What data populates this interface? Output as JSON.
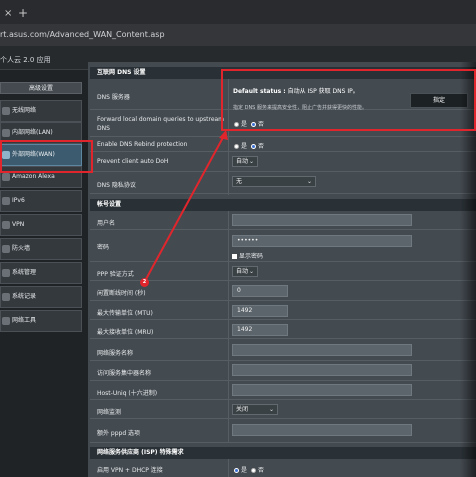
{
  "browser": {
    "close_glyph": "×",
    "newtab_glyph": "+",
    "url": "rt.asus.com/Advanced_WAN_Content.asp"
  },
  "header": {
    "app_name": "个人云 2.0 应用"
  },
  "sidebar": {
    "section_title": "高级设置",
    "items": [
      {
        "label": "无线网络",
        "icon": "wifi-icon"
      },
      {
        "label": "内部网络(LAN)",
        "icon": "home-icon"
      },
      {
        "label": "外部网络(WAN)",
        "icon": "globe-icon",
        "active": true
      },
      {
        "label": "Amazon Alexa",
        "icon": "alexa-icon"
      },
      {
        "label": "IPv6",
        "icon": "ipv6-icon"
      },
      {
        "label": "VPN",
        "icon": "vpn-icon"
      },
      {
        "label": "防火墙",
        "icon": "firewall-icon"
      },
      {
        "label": "系统管理",
        "icon": "admin-icon"
      },
      {
        "label": "系统记录",
        "icon": "log-icon"
      },
      {
        "label": "网络工具",
        "icon": "tools-icon"
      }
    ]
  },
  "dns": {
    "section_title": "互联网 DNS 设置",
    "server_label": "DNS 服务器",
    "status_prefix": "Default status :",
    "status_text": "自动从 ISP 获取 DNS IP。",
    "desc": "指定 DNS 服务来提高安全性，阻止广告并获得更快的性能。",
    "assign_button": "指定",
    "forward_label": "Forward local domain queries to upstream DNS",
    "forward_yes": "是",
    "forward_no": "否",
    "rebind_label": "Enable DNS Rebind protection",
    "rebind_yes": "是",
    "rebind_no": "否",
    "doh_label": "Prevent client auto DoH",
    "doh_value": "自动",
    "privacy_label": "DNS 隐私协议",
    "privacy_value": "无"
  },
  "account": {
    "section_title": "帐号设置",
    "username_label": "用户名",
    "username_value": "",
    "password_label": "密码",
    "password_value": "••••••",
    "show_password": "显示密码",
    "auth_label": "PPP 验证方式",
    "auth_value": "自动",
    "idle_label": "闲置断线时间 (秒)",
    "idle_value": "0",
    "mtu_label": "最大传输单位 (MTU)",
    "mtu_value": "1492",
    "mru_label": "最大接收单位 (MRU)",
    "mru_value": "1492",
    "service_label": "网络服务名称",
    "service_value": "",
    "ac_label": "访问服务集中器名称",
    "ac_value": "",
    "hostuniq_label": "Host-Uniq (十六进制)",
    "hostuniq_value": "",
    "lcp_label": "网络监测",
    "lcp_value": "关闭",
    "pppd_label": "额外 pppd 选项",
    "pppd_value": ""
  },
  "isp": {
    "section_title": "网络服务供应商 (ISP) 特殊需求",
    "vpn_dhcp_label": "启用 VPN + DHCP 连接",
    "vpn_yes": "是",
    "vpn_no": "否"
  },
  "annotation": {
    "step": "2"
  },
  "colors": {
    "highlight": "#e0262c",
    "section": "#2a3136",
    "panel": "#434a50",
    "active_nav": "#3c5b6e"
  }
}
